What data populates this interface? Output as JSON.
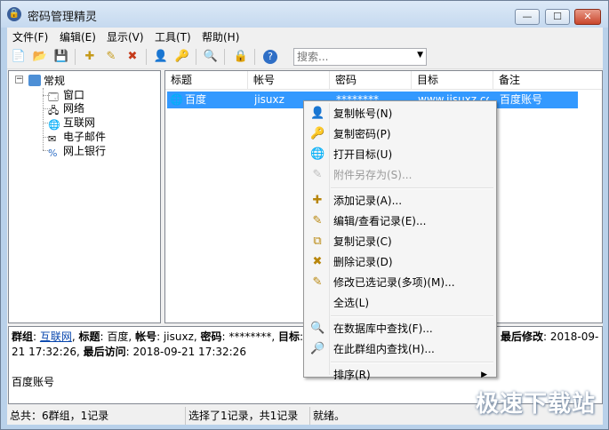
{
  "window": {
    "title": "密码管理精灵",
    "min": "—",
    "max": "☐",
    "close": "✕"
  },
  "menu": [
    "文件(F)",
    "编辑(E)",
    "显示(V)",
    "工具(T)",
    "帮助(H)"
  ],
  "search": {
    "placeholder": "搜索..."
  },
  "tree": {
    "root": "常规",
    "children": [
      "窗口",
      "网络",
      "互联网",
      "电子邮件",
      "网上银行"
    ]
  },
  "list": {
    "columns": [
      "标题",
      "帐号",
      "密码",
      "目标",
      "备注"
    ],
    "row": {
      "title": "百度",
      "account": "jisuxz",
      "password": "********",
      "target": "www.jisuxz.com",
      "note": "百度账号"
    }
  },
  "detail": {
    "group_label": "群组",
    "group_value": "互联网",
    "title_label": "标题",
    "title_value": "百度",
    "account_label": "帐号",
    "account_value": "jisuxz",
    "password_label": "密码",
    "password_value": "********",
    "target_label": "目标",
    "target_value": "www",
    "last_modified_label": "最后修改",
    "last_modified_value": "2018-09-",
    "line2_pre": "21 17:32:26",
    "last_access_label": "最后访问",
    "last_access_value": "2018-09-21 17:32:26",
    "note": "百度账号"
  },
  "status": {
    "total": "总共：6群组，1记录",
    "selected": "选择了1记录，共1记录",
    "ready": "就绪。"
  },
  "context_menu": [
    {
      "label": "复制帐号(N)",
      "icon": "user-icon",
      "glyph": "👤",
      "disabled": false
    },
    {
      "label": "复制密码(P)",
      "icon": "key-icon",
      "glyph": "🔑",
      "disabled": false
    },
    {
      "label": "打开目标(U)",
      "icon": "globe-icon",
      "glyph": "🌐",
      "disabled": false
    },
    {
      "label": "附件另存为(S)...",
      "icon": "paperclip-icon",
      "glyph": "✎",
      "disabled": true
    },
    {
      "sep": true
    },
    {
      "label": "添加记录(A)...",
      "icon": "key-add-icon",
      "glyph": "✚",
      "disabled": false
    },
    {
      "label": "编辑/查看记录(E)...",
      "icon": "key-edit-icon",
      "glyph": "✎",
      "disabled": false
    },
    {
      "label": "复制记录(C)",
      "icon": "key-copy-icon",
      "glyph": "⧉",
      "disabled": false
    },
    {
      "label": "删除记录(D)",
      "icon": "key-delete-icon",
      "glyph": "✖",
      "disabled": false
    },
    {
      "label": "修改已选记录(多项)(M)...",
      "icon": "key-multi-icon",
      "glyph": "✎",
      "disabled": false
    },
    {
      "label": "全选(L)",
      "icon": "",
      "glyph": "",
      "disabled": false
    },
    {
      "sep": true
    },
    {
      "label": "在数据库中查找(F)...",
      "icon": "search-icon",
      "glyph": "🔍",
      "disabled": false
    },
    {
      "label": "在此群组内查找(H)...",
      "icon": "search-page-icon",
      "glyph": "🔎",
      "disabled": false
    },
    {
      "sep": true
    },
    {
      "label": "排序(R)",
      "icon": "",
      "glyph": "",
      "disabled": false,
      "submenu": true
    }
  ],
  "watermark": "极速下载站"
}
